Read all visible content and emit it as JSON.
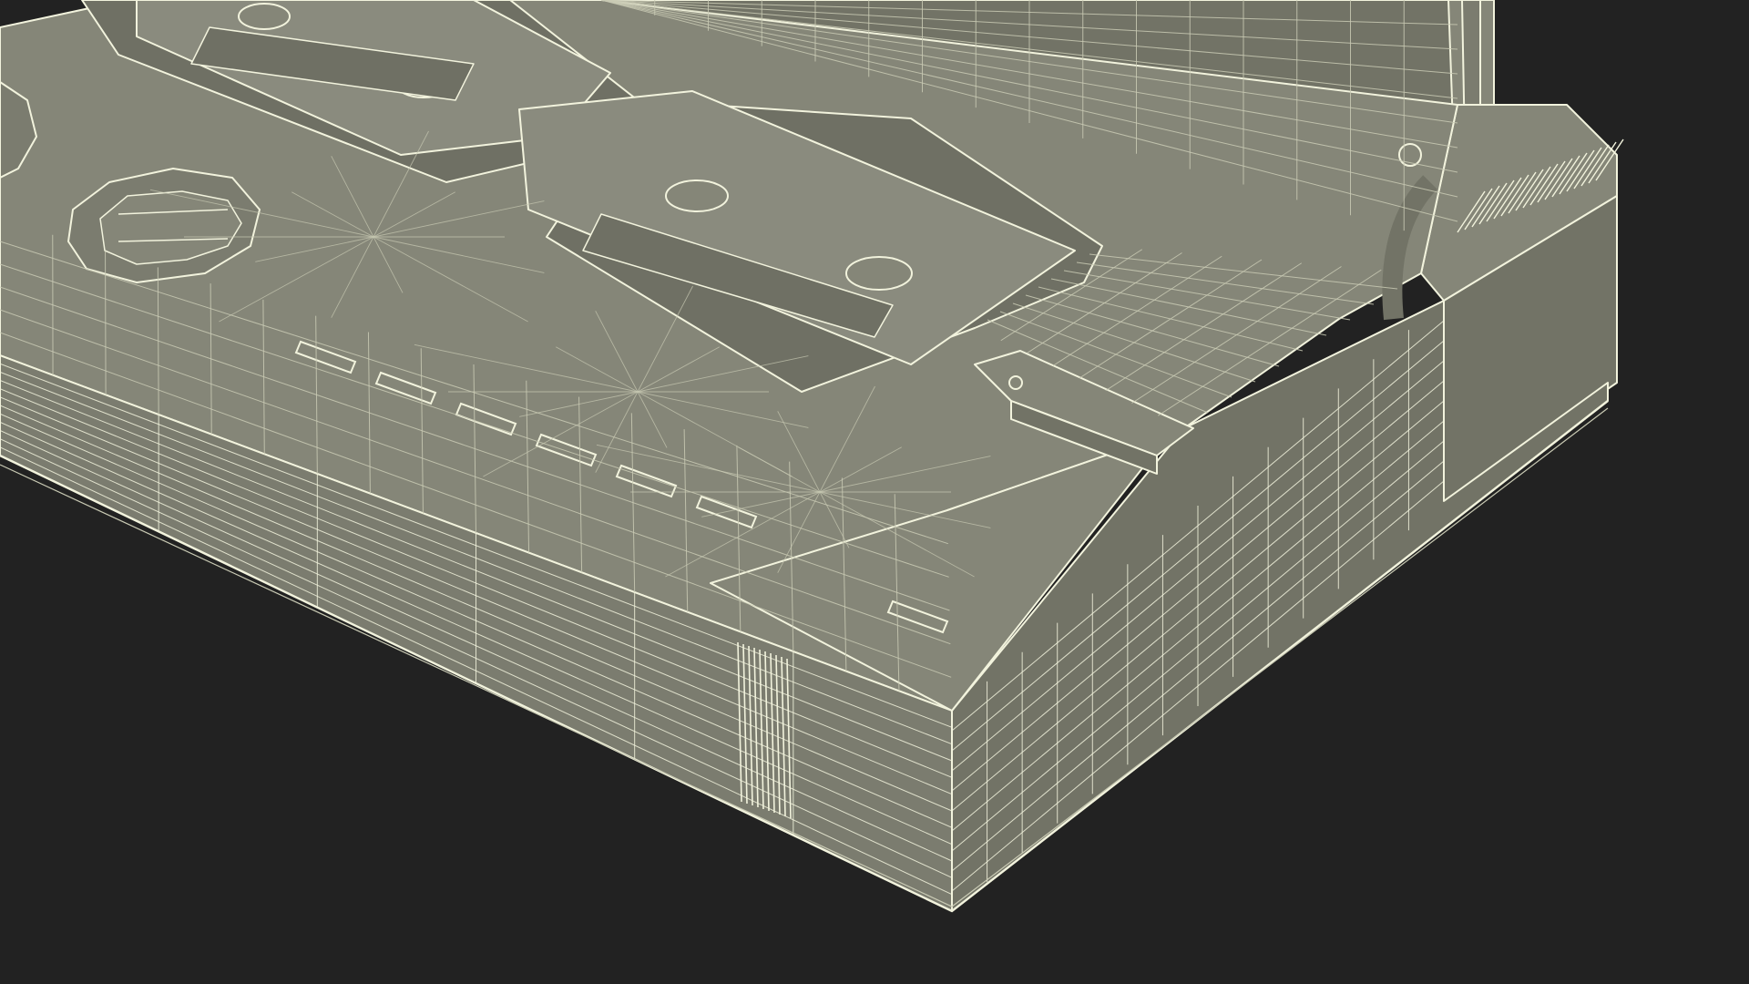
{
  "scene": {
    "subject": "cassette-deck-wireframe-render",
    "view": "perspective",
    "render_mode": "wireframe-over-shaded",
    "background_color": "#222222",
    "body_fill_top": "#858678",
    "body_fill_front": "#7b7c6f",
    "body_fill_side": "#727366",
    "tray_fill": "#6f7064",
    "cassette_fill": "#8a8b7e",
    "wire_color": "#f2f3dd",
    "wire_color_dim": "#c9cab4"
  },
  "objects": [
    {
      "name": "deck-body",
      "label": ""
    },
    {
      "name": "front-panel",
      "label": ""
    },
    {
      "name": "right-side-panel",
      "label": ""
    },
    {
      "name": "control-buttons",
      "count": 7
    },
    {
      "name": "rotary-knobs",
      "count": 2
    },
    {
      "name": "cassette-tray-left",
      "label": ""
    },
    {
      "name": "cassette-tray-right",
      "label": ""
    },
    {
      "name": "cassette-left",
      "label": ""
    },
    {
      "name": "cassette-right",
      "label": ""
    },
    {
      "name": "open-lid",
      "label": ""
    },
    {
      "name": "hinge",
      "label": ""
    },
    {
      "name": "vent-grille",
      "count": 6
    }
  ]
}
